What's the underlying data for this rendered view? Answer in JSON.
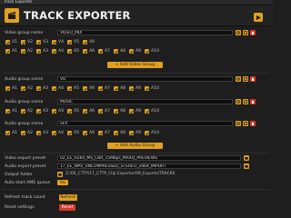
{
  "window": {
    "title": "Track Exporter"
  },
  "header": {
    "title": "TRACK EXPORTER",
    "accent": "#e0a020",
    "danger": "#d83a2a"
  },
  "video_group": {
    "label": "Video group name",
    "value": "VIDEO_MIX",
    "video_tracks": [
      "V1",
      "V2",
      "V3",
      "V4",
      "V5",
      "V6"
    ],
    "audio_tracks": [
      "A1",
      "A2",
      "A3",
      "A4",
      "A5",
      "A6",
      "A7",
      "A8",
      "A9",
      "A10"
    ],
    "add_label": "+ Add Video Group"
  },
  "audio_groups": [
    {
      "label": "Audio group name",
      "value": "VO",
      "tracks": [
        "A1",
        "A2",
        "A3",
        "A4",
        "A5",
        "A6",
        "A7",
        "A8",
        "A9",
        "A10"
      ]
    },
    {
      "label": "Audio group name",
      "value": "MUSIC",
      "tracks": [
        "A1",
        "A2",
        "A3",
        "A4",
        "A5",
        "A6",
        "A7",
        "A8",
        "A9",
        "A10"
      ]
    },
    {
      "label": "Audio group name",
      "value": "SFX",
      "tracks": [
        "A1",
        "A2",
        "A3",
        "A4",
        "A5",
        "A6",
        "A7",
        "A8",
        "A9",
        "A10"
      ]
    }
  ],
  "add_audio_label": "+ Add Audio Group",
  "presets": {
    "video_label": "Video export preset",
    "video_value": "02_EE_H264_MS_CBR_15Mbps_MAXQ_PREVIEWS",
    "audio_label": "Audio export preset",
    "audio_value": "17_EE_WAV_UNCOMPRESSED_STEREO_24bit_IMPORT"
  },
  "output": {
    "label": "Output folder",
    "value": "Z:/00_CTTP/17_CTTP_Clip Exporter/09_Exports/TRACKS"
  },
  "auto_start": {
    "label": "Auto start AME queue",
    "value": "Yes"
  },
  "refresh": {
    "label": "Refresh track count",
    "button": "Refresh"
  },
  "reset": {
    "label": "Reset settings",
    "button": "Reset"
  }
}
